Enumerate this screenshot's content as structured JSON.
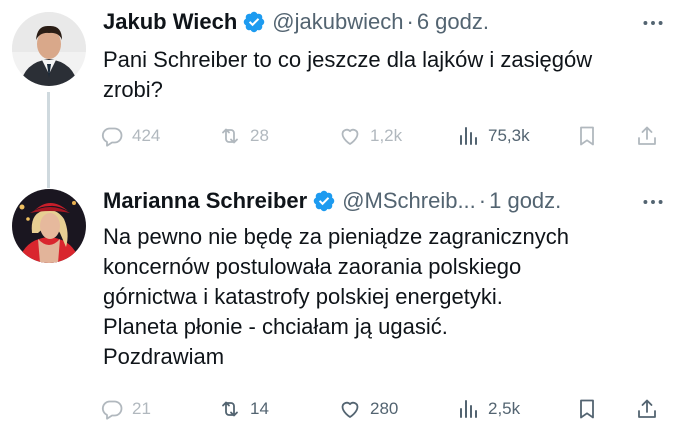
{
  "colors": {
    "verified_badge": "#1d9bf0",
    "secondary_text": "#536471",
    "primary_text": "#0f1419",
    "thread_line": "#cfd9de"
  },
  "tweets": [
    {
      "name": "Jakub Wiech",
      "handle": "@jakubwiech",
      "separator": "·",
      "time": "6 godz.",
      "text": [
        "Pani Schreiber to co jeszcze dla lajków i zasięgów",
        "zrobi?"
      ],
      "replies": "424",
      "retweets": "28",
      "likes": "1,2k",
      "views": "75,3k",
      "icons": [
        "reply-icon",
        "retweet-icon",
        "like-icon",
        "views-icon",
        "bookmark-icon",
        "share-icon",
        "more-icon",
        "verified-icon"
      ]
    },
    {
      "name": "Marianna Schreiber",
      "handle": "@MSchreib...",
      "separator": "·",
      "time": "1 godz.",
      "text": [
        "Na pewno nie będę za pieniądze zagranicznych",
        "koncernów postulowała zaorania polskiego",
        "górnictwa i katastrofy polskiej energetyki.",
        "Planeta płonie - chciałam ją ugasić.",
        "Pozdrawiam"
      ],
      "replies": "21",
      "retweets": "14",
      "likes": "280",
      "views": "2,5k",
      "icons": [
        "reply-icon",
        "retweet-icon",
        "like-icon",
        "views-icon",
        "bookmark-icon",
        "share-icon",
        "more-icon",
        "verified-icon"
      ]
    }
  ]
}
